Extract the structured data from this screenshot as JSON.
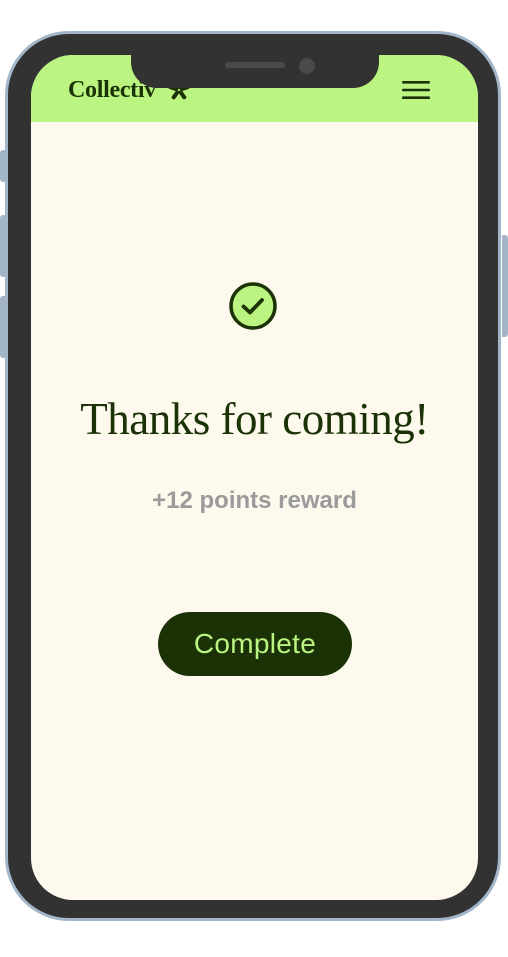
{
  "header": {
    "brand_name": "Collectiv",
    "logo_icon": "sparkle-asterisk-icon",
    "menu_icon": "hamburger-menu-icon"
  },
  "main": {
    "status_icon": "check-circle-icon",
    "title": "Thanks for coming!",
    "reward_text": "+12 points reward",
    "complete_button_label": "Complete"
  },
  "colors": {
    "header_background": "#bbf480",
    "screen_background": "#fdf9ed",
    "brand_dark_green": "#1a3205",
    "muted_gray": "#9b9b9b",
    "device_frame": "#323232",
    "device_border": "#a3b5c9"
  }
}
